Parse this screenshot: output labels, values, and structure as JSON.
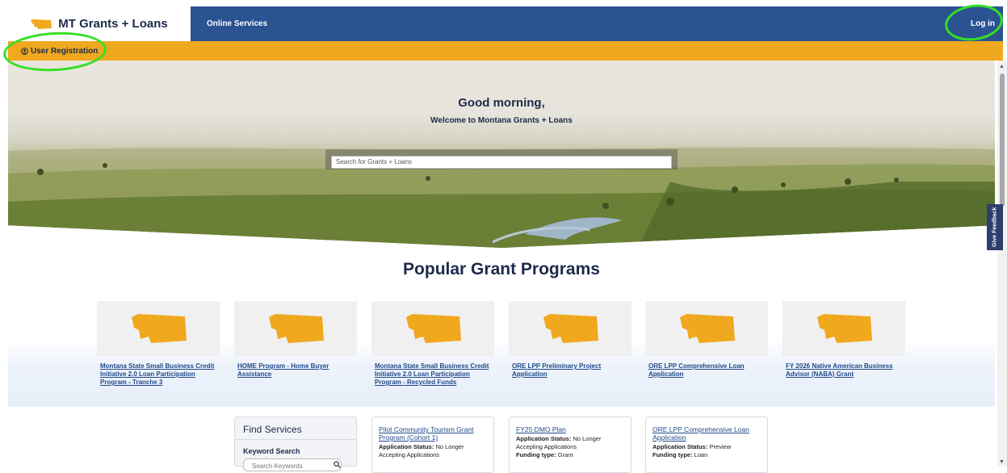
{
  "header": {
    "brand": "MT Grants + Loans",
    "nav_link": "Online Services",
    "login": "Log in"
  },
  "subbar": {
    "registration": "User Registration"
  },
  "hero": {
    "greeting": "Good morning,",
    "welcome": "Welcome to Montana Grants + Loans",
    "search_placeholder": "Search for Grants + Loans"
  },
  "feedback_tab": "Give Feedback",
  "popular": {
    "title": "Popular Grant Programs",
    "programs": [
      {
        "label": "Montana State Small Business Credit Initiative 2.0 Loan Participation Program - Tranche 3"
      },
      {
        "label": "HOME Program - Home Buyer Assistance"
      },
      {
        "label": "Montana State Small Business Credit Initiative 2.0 Loan Participation Program - Recycled Funds"
      },
      {
        "label": "ORE LPP Preliminary Project Application"
      },
      {
        "label": "ORE LPP Comprehensive Loan Application"
      },
      {
        "label": "FY 2026 Native American Business Advisor (NABA) Grant"
      }
    ]
  },
  "find_services": {
    "title": "Find Services",
    "keyword_label": "Keyword Search",
    "keyword_placeholder": "Search Keywords"
  },
  "listings": [
    {
      "title": "Pilot Community Tourism Grant Program (Cohort 1)",
      "status_label": "Application Status:",
      "status_value": "No Longer Accepting Applications",
      "funding_label": "",
      "funding_value": ""
    },
    {
      "title": "FY25 DMO Plan",
      "status_label": "Application Status:",
      "status_value": "No Longer Accepting Applications",
      "funding_label": "Funding type:",
      "funding_value": "Grant"
    },
    {
      "title": "ORE LPP Comprehensive Loan Application",
      "status_label": "Application Status:",
      "status_value": "Preview",
      "funding_label": "Funding type:",
      "funding_value": "Loan"
    }
  ],
  "colors": {
    "navy": "#2b5392",
    "gold": "#f0a81e",
    "title_navy": "#1d2a4a",
    "link_blue": "#1f4a8a",
    "annotation_green": "#32e024"
  },
  "icons": [
    "montana-state-icon",
    "user-circle-icon",
    "search-icon"
  ]
}
